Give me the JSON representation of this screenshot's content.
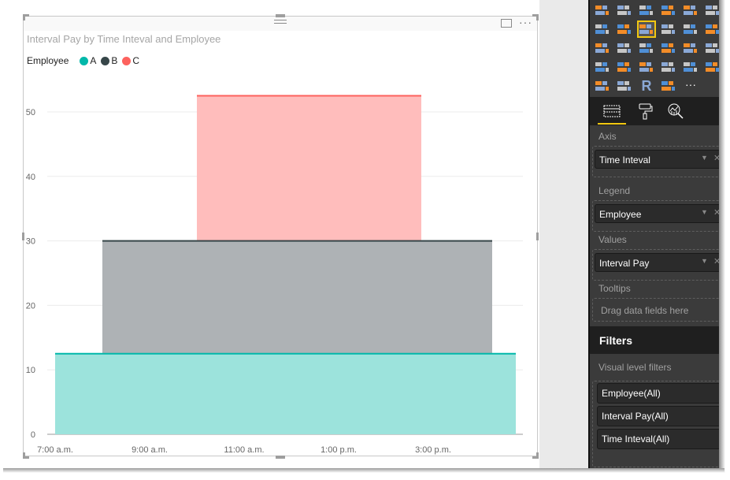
{
  "visual": {
    "title": "Interval Pay by Time Inteval and Employee",
    "more_options_icon": "ellipsis-icon",
    "focus_mode_icon": "focus-mode-icon",
    "legend": {
      "title": "Employee",
      "items": [
        {
          "label": "A",
          "color": "#01B8AA"
        },
        {
          "label": "B",
          "color": "#374649"
        },
        {
          "label": "C",
          "color": "#FD625E"
        }
      ]
    }
  },
  "chart_data": {
    "type": "area",
    "title": "Interval Pay by Time Inteval and Employee",
    "xlabel": "",
    "ylabel": "",
    "x_unit": "hour of day",
    "x_ticks": [
      {
        "label": "7:00 a.m.",
        "hour": 7
      },
      {
        "label": "9:00 a.m.",
        "hour": 9
      },
      {
        "label": "11:00 a.m.",
        "hour": 11
      },
      {
        "label": "1:00 p.m.",
        "hour": 13
      },
      {
        "label": "3:00 p.m.",
        "hour": 15
      }
    ],
    "x_range": [
      7,
      17
    ],
    "y_ticks": [
      0,
      10,
      20,
      30,
      40,
      50
    ],
    "ylim": [
      0,
      55
    ],
    "grid": true,
    "legend_position": "top-left",
    "series": [
      {
        "name": "A",
        "color": "#01B8AA",
        "fill": "#9CE3DC",
        "x": [
          7,
          16.75
        ],
        "base": 0,
        "value": 12.5
      },
      {
        "name": "B",
        "color": "#374649",
        "fill": "#AEB2B5",
        "x": [
          8,
          16.25
        ],
        "base": 12.5,
        "value": 30
      },
      {
        "name": "C",
        "color": "#FD625E",
        "fill": "#FFBDBC",
        "x": [
          10,
          14.75
        ],
        "base": 30,
        "value": 52.5
      }
    ]
  },
  "pane": {
    "gallery_icons": [
      "stacked-bar-icon",
      "stacked-column-icon",
      "clustered-bar-icon",
      "clustered-column-icon",
      "100-stacked-bar-icon",
      "100-stacked-column-icon",
      "line-chart-icon",
      "area-chart-icon",
      "stacked-area-icon",
      "line-clustered-column-icon",
      "line-stacked-column-icon",
      "ribbon-chart-icon",
      "scatter-icon",
      "pie-icon",
      "treemap-icon",
      "globe-map-icon",
      "table-icon",
      "matrix-icon",
      "filled-map-icon",
      "funnel-icon",
      "gauge-icon",
      "slicer-icon",
      "card-icon",
      "kpi-icon",
      "filter-icon",
      "donut-icon",
      "r-visual-icon",
      "table-2-icon",
      "more-visuals-icon"
    ],
    "tabs": [
      {
        "name": "fields-tab",
        "icon": "fields-icon"
      },
      {
        "name": "format-tab",
        "icon": "paint-roller-icon"
      },
      {
        "name": "analytics-tab",
        "icon": "analytics-icon"
      }
    ],
    "wells": {
      "axis": {
        "label": "Axis",
        "field": "Time Inteval"
      },
      "legend": {
        "label": "Legend",
        "field": "Employee"
      },
      "values": {
        "label": "Values",
        "field": "Interval Pay"
      },
      "tooltips": {
        "label": "Tooltips",
        "placeholder": "Drag data fields here"
      }
    },
    "filters": {
      "header": "Filters",
      "section_label": "Visual level filters",
      "items": [
        "Employee(All)",
        "Interval Pay(All)",
        "Time Inteval(All)"
      ]
    }
  }
}
